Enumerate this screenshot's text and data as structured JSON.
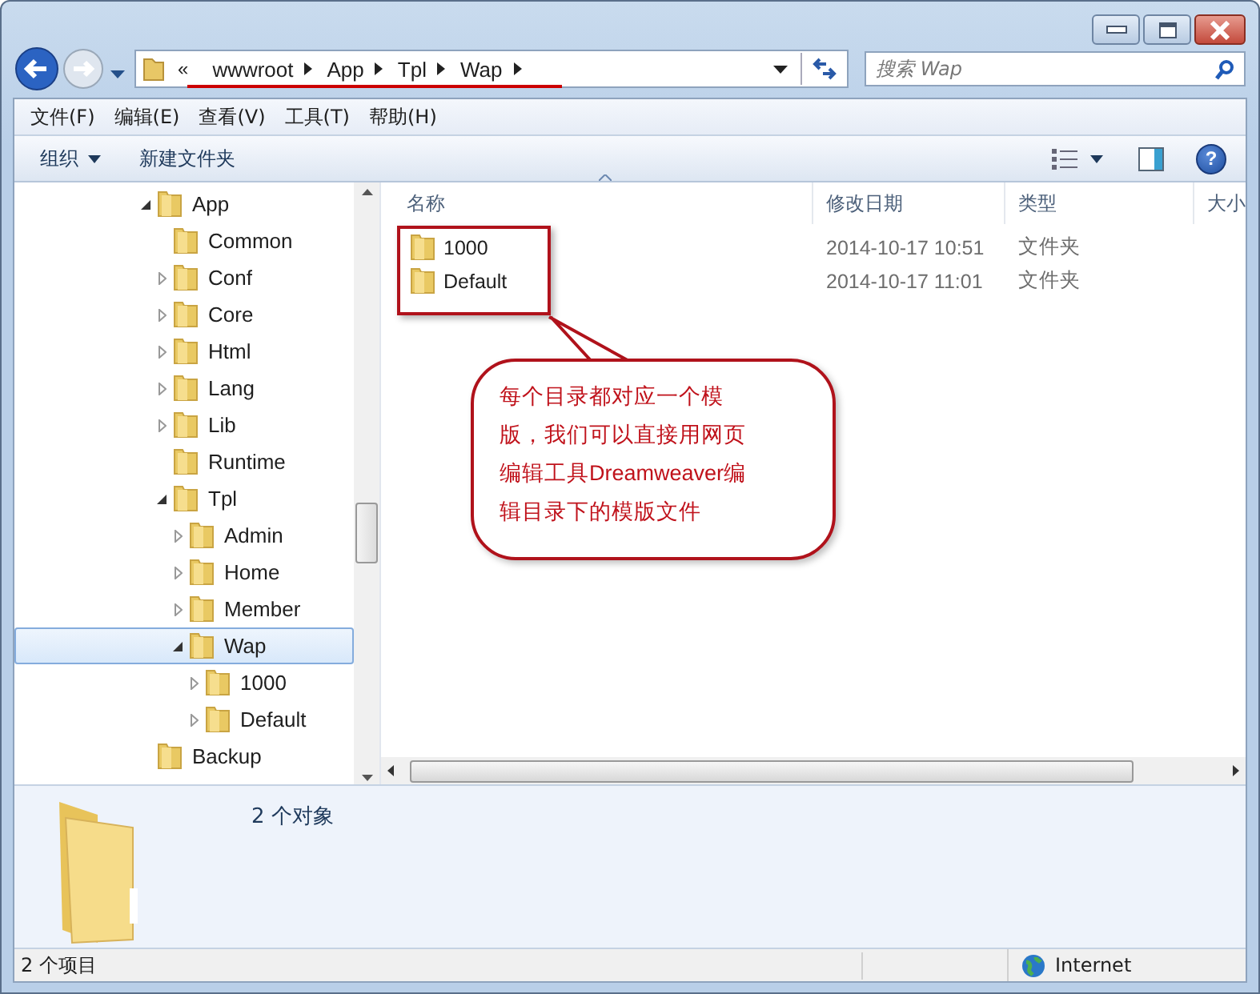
{
  "breadcrumb": {
    "overflow": "«",
    "items": [
      "wwwroot",
      "App",
      "Tpl",
      "Wap"
    ]
  },
  "search": {
    "placeholder": "搜索 Wap"
  },
  "menu": [
    "文件(F)",
    "编辑(E)",
    "查看(V)",
    "工具(T)",
    "帮助(H)"
  ],
  "toolbar": {
    "organize": "组织",
    "new_folder": "新建文件夹",
    "help": "?"
  },
  "tree": [
    {
      "label": "App",
      "kind": "branch",
      "expanded": true,
      "selected": false,
      "children": [
        {
          "label": "Common",
          "kind": "leaf",
          "selected": false
        },
        {
          "label": "Conf",
          "kind": "branch",
          "expanded": false,
          "selected": false
        },
        {
          "label": "Core",
          "kind": "branch",
          "expanded": false,
          "selected": false
        },
        {
          "label": "Html",
          "kind": "branch",
          "expanded": false,
          "selected": false
        },
        {
          "label": "Lang",
          "kind": "branch",
          "expanded": false,
          "selected": false
        },
        {
          "label": "Lib",
          "kind": "branch",
          "expanded": false,
          "selected": false
        },
        {
          "label": "Runtime",
          "kind": "leaf",
          "selected": false
        },
        {
          "label": "Tpl",
          "kind": "branch",
          "expanded": true,
          "selected": false,
          "children": [
            {
              "label": "Admin",
              "kind": "branch",
              "expanded": false,
              "selected": false
            },
            {
              "label": "Home",
              "kind": "branch",
              "expanded": false,
              "selected": false
            },
            {
              "label": "Member",
              "kind": "branch",
              "expanded": false,
              "selected": false
            },
            {
              "label": "Wap",
              "kind": "branch",
              "expanded": true,
              "selected": true,
              "children": [
                {
                  "label": "1000",
                  "kind": "branch",
                  "expanded": false,
                  "selected": false
                },
                {
                  "label": "Default",
                  "kind": "branch",
                  "expanded": false,
                  "selected": false
                }
              ]
            }
          ]
        }
      ]
    },
    {
      "label": "Backup",
      "kind": "leaf",
      "selected": false
    }
  ],
  "table": {
    "columns": [
      "名称",
      "修改日期",
      "类型",
      "大小"
    ],
    "rows": [
      {
        "name": "1000",
        "date": "2014-10-17 10:51",
        "type": "文件夹"
      },
      {
        "name": "Default",
        "date": "2014-10-17 11:01",
        "type": "文件夹"
      }
    ]
  },
  "callout": {
    "text": "每个目录都对应一个模版，我们可以直接用网页编辑工具Dreamweaver编辑目录下的模版文件"
  },
  "details": {
    "count": "2 个对象"
  },
  "status_bar": {
    "items": "2 个项目",
    "zone": "Internet"
  }
}
